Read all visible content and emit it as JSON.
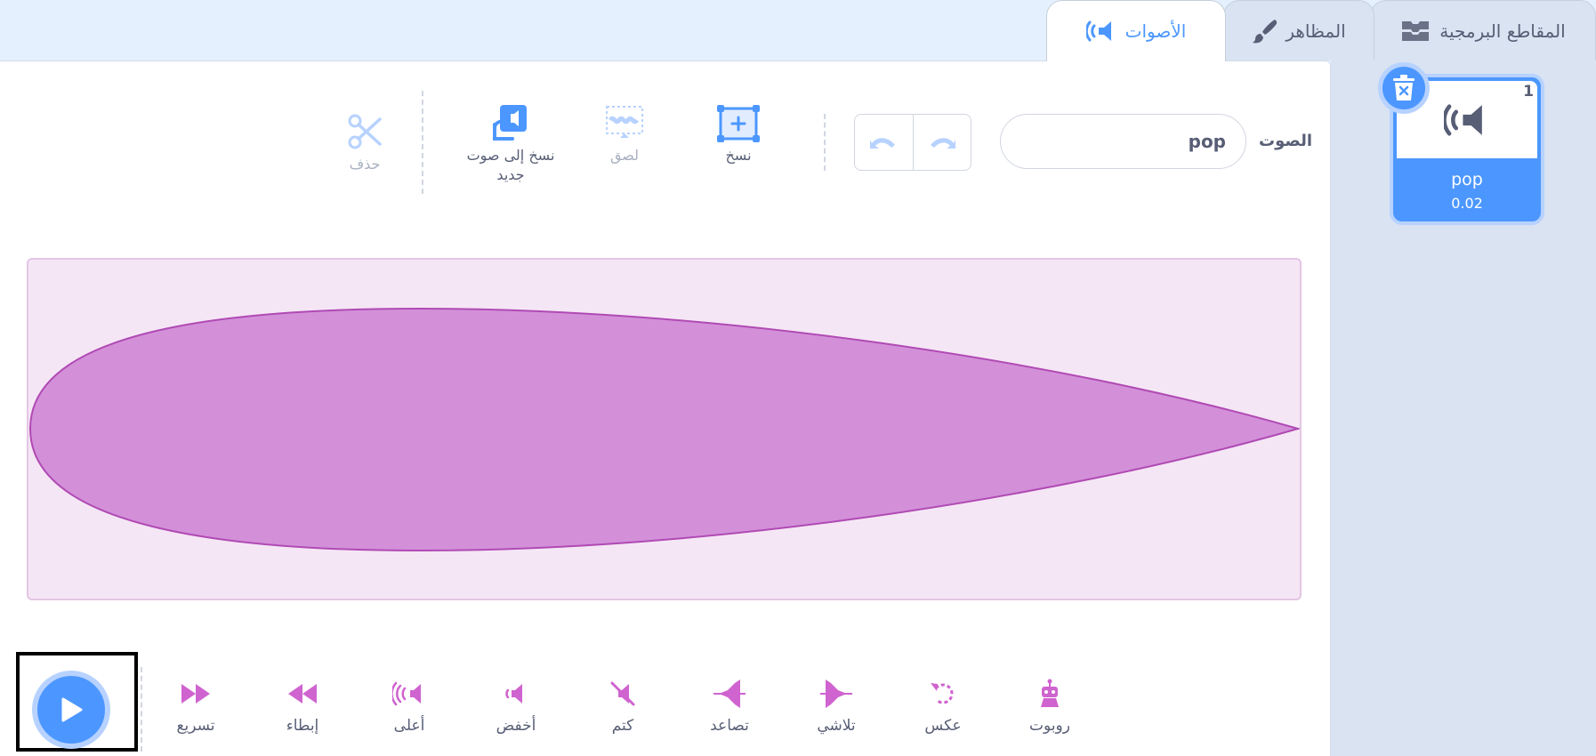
{
  "tabs": {
    "code": "المقاطع البرمجية",
    "costumes": "المظاهر",
    "sounds": "الأصوات"
  },
  "editor": {
    "sound_label": "الصوت",
    "sound_name": "pop",
    "tools": {
      "copy": "نسخ",
      "paste": "لصق",
      "copy_to_new_line1": "نسخ إلى صوت",
      "copy_to_new_line2": "جديد",
      "delete": "حذف"
    }
  },
  "effects": [
    {
      "label": "تسريع",
      "icon": "faster-icon"
    },
    {
      "label": "إبطاء",
      "icon": "slower-icon"
    },
    {
      "label": "أعلى",
      "icon": "louder-icon"
    },
    {
      "label": "أخفض",
      "icon": "softer-icon"
    },
    {
      "label": "كتم",
      "icon": "mute-icon"
    },
    {
      "label": "تصاعد",
      "icon": "fade-in-icon"
    },
    {
      "label": "تلاشي",
      "icon": "fade-out-icon"
    },
    {
      "label": "عكس",
      "icon": "reverse-icon"
    },
    {
      "label": "روبوت",
      "icon": "robot-icon"
    }
  ],
  "sound_list": [
    {
      "index": "1",
      "name": "pop",
      "duration": "0.02"
    }
  ],
  "colors": {
    "accent": "#4c97ff",
    "effect": "#cf63cf",
    "wave_fill": "#d390d9",
    "wave_bg": "#f5e6f5"
  }
}
